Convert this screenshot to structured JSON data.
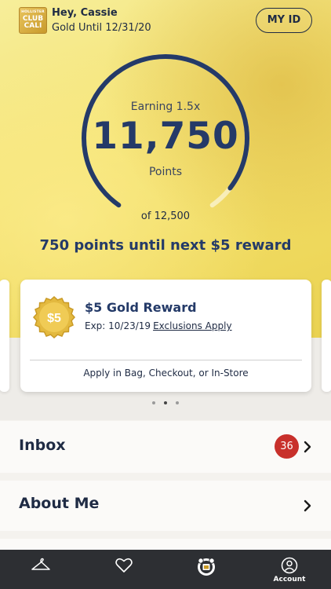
{
  "header": {
    "logo_lines": [
      "HOLLISTER",
      "CLUB",
      "CALI"
    ],
    "greeting": "Hey, Cassie",
    "tier": "Gold Until 12/31/20",
    "my_id_label": "MY ID"
  },
  "points": {
    "earning_label": "Earning 1.5x",
    "value": "11,750",
    "unit_label": "Points",
    "total_label": "of 12,500",
    "progress_fraction": 0.94,
    "next_reward_text": "750 points until next $5 reward"
  },
  "reward_card": {
    "badge_text": "$5",
    "title": "$5 Gold Reward",
    "exp_text": "Exp: 10/23/19",
    "exclusions_link": "Exclusions Apply",
    "apply_text": "Apply in Bag, Checkout, or In-Store"
  },
  "carousel": {
    "page_count": 3,
    "active_index": 1
  },
  "rows": {
    "inbox_label": "Inbox",
    "inbox_count": "36",
    "about_label": "About Me"
  },
  "tabbar": {
    "account_label": "Account",
    "icons": [
      "hanger-icon",
      "heart-icon",
      "rewards-bear-icon",
      "account-icon"
    ]
  },
  "colors": {
    "navy": "#243a68",
    "gold_background": "#f4e374",
    "badge_red": "#c8302b",
    "tabbar": "#2d2f33"
  }
}
